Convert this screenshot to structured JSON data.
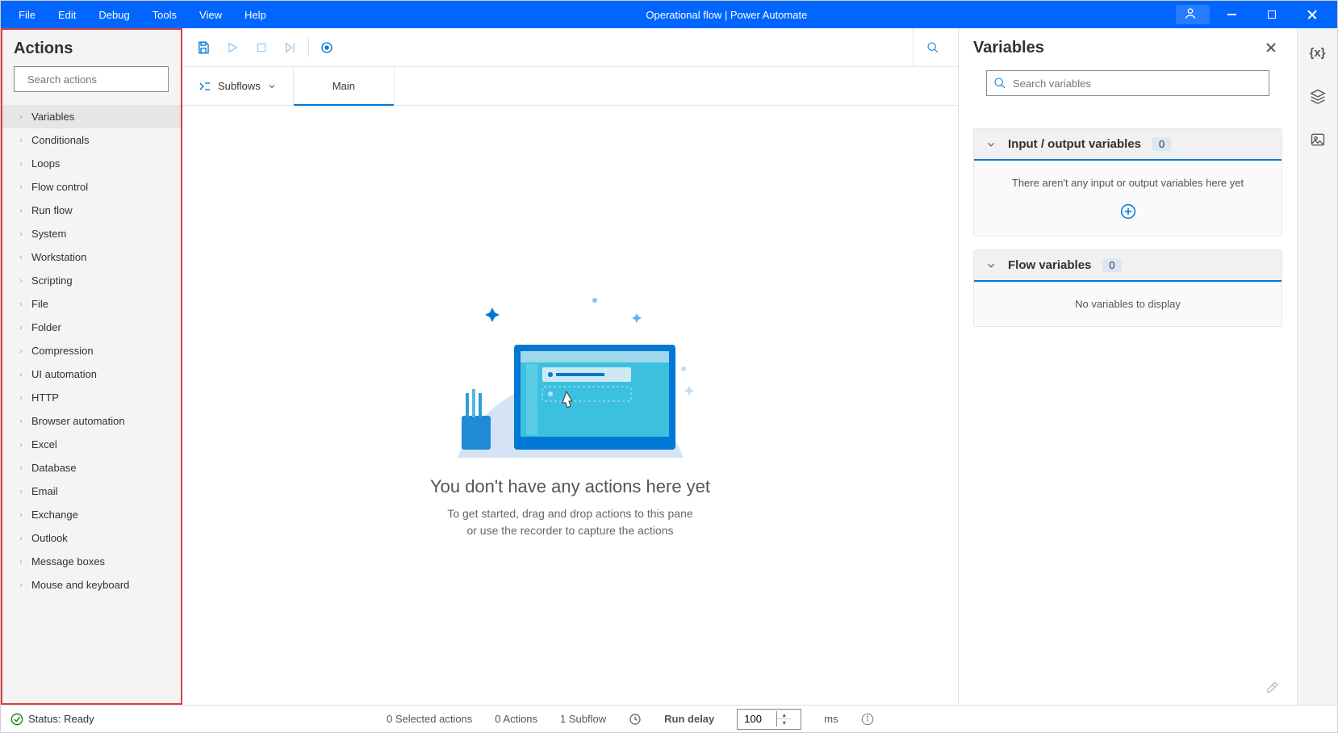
{
  "window": {
    "title": "Operational flow | Power Automate",
    "account_label": ""
  },
  "menus": [
    "File",
    "Edit",
    "Debug",
    "Tools",
    "View",
    "Help"
  ],
  "actions_panel": {
    "title": "Actions",
    "search_placeholder": "Search actions",
    "categories": [
      "Variables",
      "Conditionals",
      "Loops",
      "Flow control",
      "Run flow",
      "System",
      "Workstation",
      "Scripting",
      "File",
      "Folder",
      "Compression",
      "UI automation",
      "HTTP",
      "Browser automation",
      "Excel",
      "Database",
      "Email",
      "Exchange",
      "Outlook",
      "Message boxes",
      "Mouse and keyboard"
    ],
    "selected_index": 0
  },
  "tabstrip": {
    "subflows_label": "Subflows",
    "main_tab": "Main"
  },
  "canvas": {
    "empty_title": "You don't have any actions here yet",
    "empty_line1": "To get started, drag and drop actions to this pane",
    "empty_line2": "or use the recorder to capture the actions"
  },
  "variables": {
    "title": "Variables",
    "search_placeholder": "Search variables",
    "io_title": "Input / output variables",
    "io_count": "0",
    "io_empty": "There aren't any input or output variables here yet",
    "flow_title": "Flow variables",
    "flow_count": "0",
    "flow_empty": "No variables to display"
  },
  "statusbar": {
    "status_label": "Status: Ready",
    "selected": "0 Selected actions",
    "actions": "0 Actions",
    "subflows": "1 Subflow",
    "delay_label": "Run delay",
    "delay_value": "100",
    "delay_unit": "ms"
  }
}
